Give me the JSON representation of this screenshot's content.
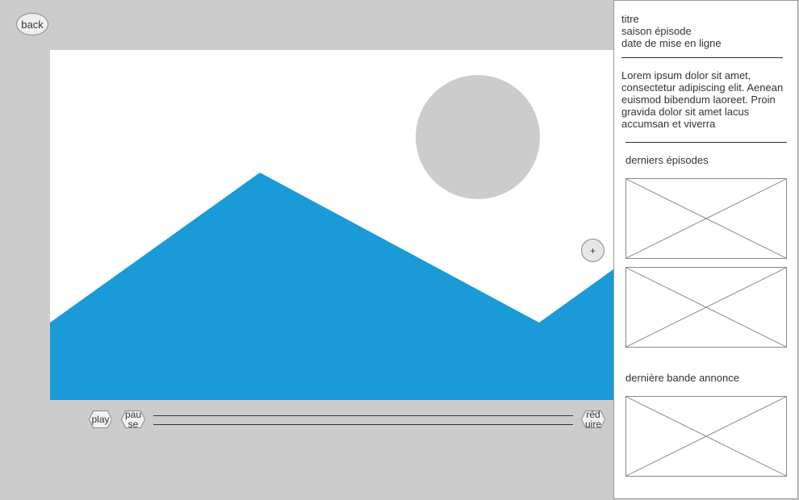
{
  "nav": {
    "back_label": "back"
  },
  "player": {
    "add_label": "+",
    "play_label": "play",
    "pause_label": "pause",
    "reduce_label": "réduire",
    "colors": {
      "mountain": "#1a9ad6",
      "sun": "#cccccc",
      "sky": "#ffffff"
    }
  },
  "sidebar": {
    "title": "titre",
    "season_episode": "saison épisode",
    "release_date": "date de mise en ligne",
    "description": "Lorem ipsum dolor sit amet, consectetur adipiscing elit. Aenean euismod bibendum laoreet. Proin gravida dolor sit amet lacus accumsan et viverra",
    "latest_episodes_heading": "derniers épisodes",
    "latest_trailer_heading": "dernière bande annonce"
  }
}
